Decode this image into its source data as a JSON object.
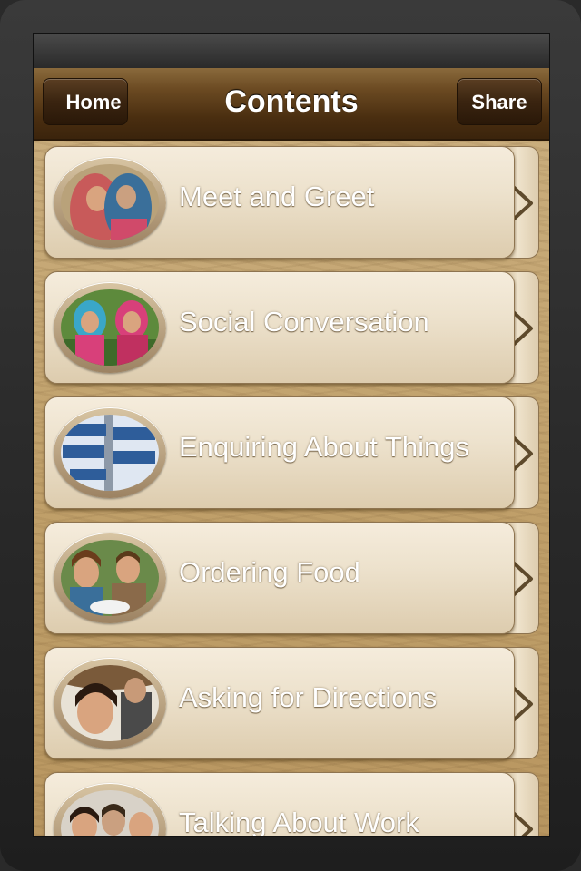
{
  "navbar": {
    "title": "Contents",
    "home_label": "Home",
    "share_label": "Share"
  },
  "menu": {
    "items": [
      {
        "label": "Meet and Greet",
        "thumb": "photo-women-greeting"
      },
      {
        "label": "Social Conversation",
        "thumb": "photo-two-women"
      },
      {
        "label": "Enquiring About Things",
        "thumb": "photo-signpost-questions"
      },
      {
        "label": "Ordering Food",
        "thumb": "photo-people-dining"
      },
      {
        "label": "Asking for Directions",
        "thumb": "photo-woman-thinking"
      },
      {
        "label": "Talking About Work",
        "thumb": "photo-coworkers"
      }
    ]
  },
  "colors": {
    "navbar": "#4a2e10",
    "row_background": "#ede2cd",
    "wood_background": "#c0a06a"
  }
}
